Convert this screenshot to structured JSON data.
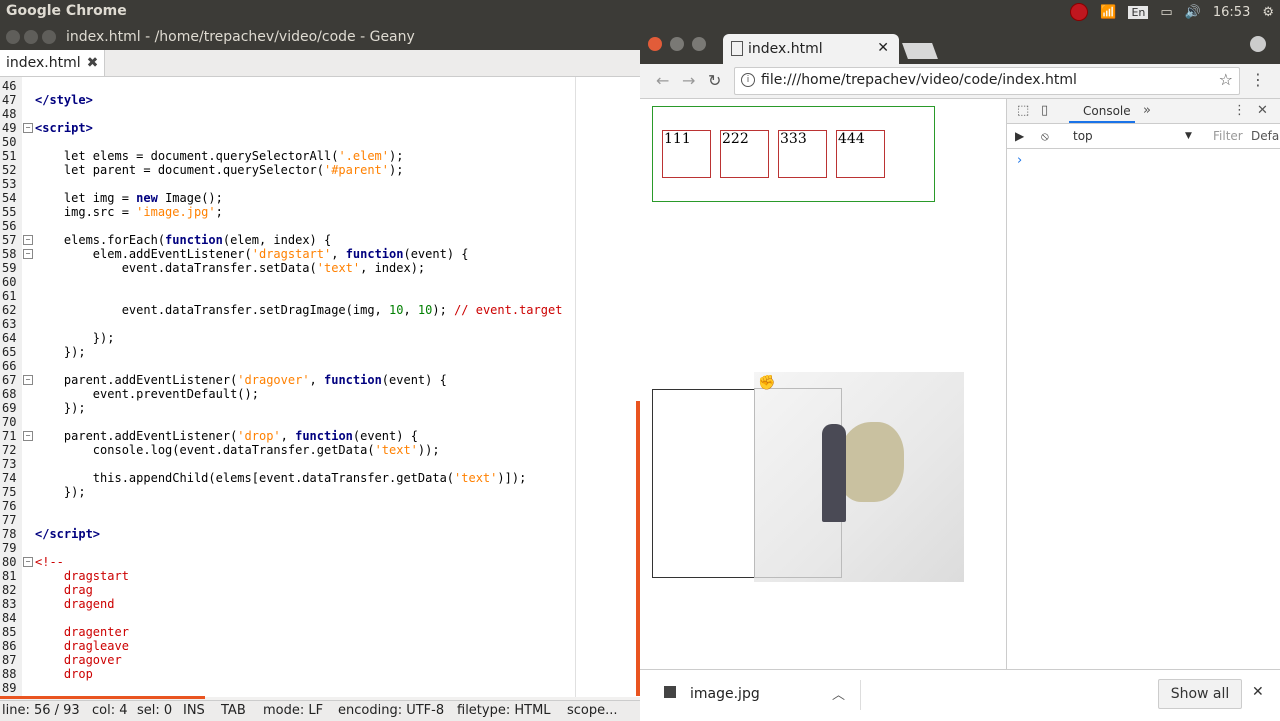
{
  "desktop": {
    "app_title": "Google Chrome",
    "tray": {
      "lang": "En",
      "time": "16:53"
    }
  },
  "geany": {
    "window_title": "index.html - /home/trepachev/video/code - Geany",
    "tab_label": "index.html",
    "lines": [
      {
        "n": "46",
        "html": ""
      },
      {
        "n": "47",
        "html": "<span class=\"tag\">&lt;/style&gt;</span>"
      },
      {
        "n": "48",
        "html": ""
      },
      {
        "n": "49",
        "html": "<span class=\"tag\">&lt;script&gt;</span>"
      },
      {
        "n": "50",
        "html": ""
      },
      {
        "n": "51",
        "html": "    let elems = document.querySelectorAll(<span class=\"str\">'.elem'</span>);"
      },
      {
        "n": "52",
        "html": "    let parent = document.querySelector(<span class=\"str\">'#parent'</span>);"
      },
      {
        "n": "53",
        "html": ""
      },
      {
        "n": "54",
        "html": "    let img = <span class=\"kw\">new</span> Image();"
      },
      {
        "n": "55",
        "html": "    img.src = <span class=\"str\">'image.jpg'</span>;"
      },
      {
        "n": "56",
        "html": ""
      },
      {
        "n": "57",
        "html": "    elems.forEach(<span class=\"kw\">function</span>(elem, index) {"
      },
      {
        "n": "58",
        "html": "        elem.addEventListener(<span class=\"str\">'dragstart'</span>, <span class=\"kw\">function</span>(event) {"
      },
      {
        "n": "59",
        "html": "            event.dataTransfer.setData(<span class=\"str\">'text'</span>, index);"
      },
      {
        "n": "60",
        "html": ""
      },
      {
        "n": "61",
        "html": ""
      },
      {
        "n": "62",
        "html": "            event.dataTransfer.setDragImage(img, <span class=\"num\">10</span>, <span class=\"num\">10</span>); <span class=\"cmt\">// event.target</span>"
      },
      {
        "n": "63",
        "html": ""
      },
      {
        "n": "64",
        "html": "        });"
      },
      {
        "n": "65",
        "html": "    });"
      },
      {
        "n": "66",
        "html": ""
      },
      {
        "n": "67",
        "html": "    parent.addEventListener(<span class=\"str\">'dragover'</span>, <span class=\"kw\">function</span>(event) {"
      },
      {
        "n": "68",
        "html": "        event.preventDefault();"
      },
      {
        "n": "69",
        "html": "    });"
      },
      {
        "n": "70",
        "html": ""
      },
      {
        "n": "71",
        "html": "    parent.addEventListener(<span class=\"str\">'drop'</span>, <span class=\"kw\">function</span>(event) {"
      },
      {
        "n": "72",
        "html": "        console.log(event.dataTransfer.getData(<span class=\"str\">'text'</span>));"
      },
      {
        "n": "73",
        "html": ""
      },
      {
        "n": "74",
        "html": "        this.appendChild(elems[event.dataTransfer.getData(<span class=\"str\">'text'</span>)]);"
      },
      {
        "n": "75",
        "html": "    });"
      },
      {
        "n": "76",
        "html": ""
      },
      {
        "n": "77",
        "html": ""
      },
      {
        "n": "78",
        "html": "<span class=\"tag\">&lt;/script&gt;</span>"
      },
      {
        "n": "79",
        "html": ""
      },
      {
        "n": "80",
        "html": "<span class=\"cmt\">&lt;!--</span>"
      },
      {
        "n": "81",
        "html": "<span class=\"cmt\">    dragstart</span>"
      },
      {
        "n": "82",
        "html": "<span class=\"cmt\">    drag</span>"
      },
      {
        "n": "83",
        "html": "<span class=\"cmt\">    dragend</span>"
      },
      {
        "n": "84",
        "html": ""
      },
      {
        "n": "85",
        "html": "<span class=\"cmt\">    dragenter</span>"
      },
      {
        "n": "86",
        "html": "<span class=\"cmt\">    dragleave</span>"
      },
      {
        "n": "87",
        "html": "<span class=\"cmt\">    dragover</span>"
      },
      {
        "n": "88",
        "html": "<span class=\"cmt\">    drop</span>"
      },
      {
        "n": "89",
        "html": ""
      }
    ],
    "status": {
      "line": "line: 56 / 93",
      "col": "col: 4",
      "sel": "sel: 0",
      "ins": "INS",
      "tab": "TAB",
      "mode": "mode: LF",
      "encoding": "encoding: UTF-8",
      "filetype": "filetype: HTML",
      "scope": "scope..."
    }
  },
  "chrome": {
    "tab_title": "index.html",
    "url": "file:///home/trepachev/video/code/index.html",
    "elems": [
      "111",
      "222",
      "333",
      "444"
    ],
    "devtools": {
      "console_tab": "Console",
      "context": "top",
      "filter_placeholder": "Filter",
      "levels": "Defa"
    },
    "download": {
      "file": "image.jpg",
      "show_all": "Show all"
    }
  }
}
